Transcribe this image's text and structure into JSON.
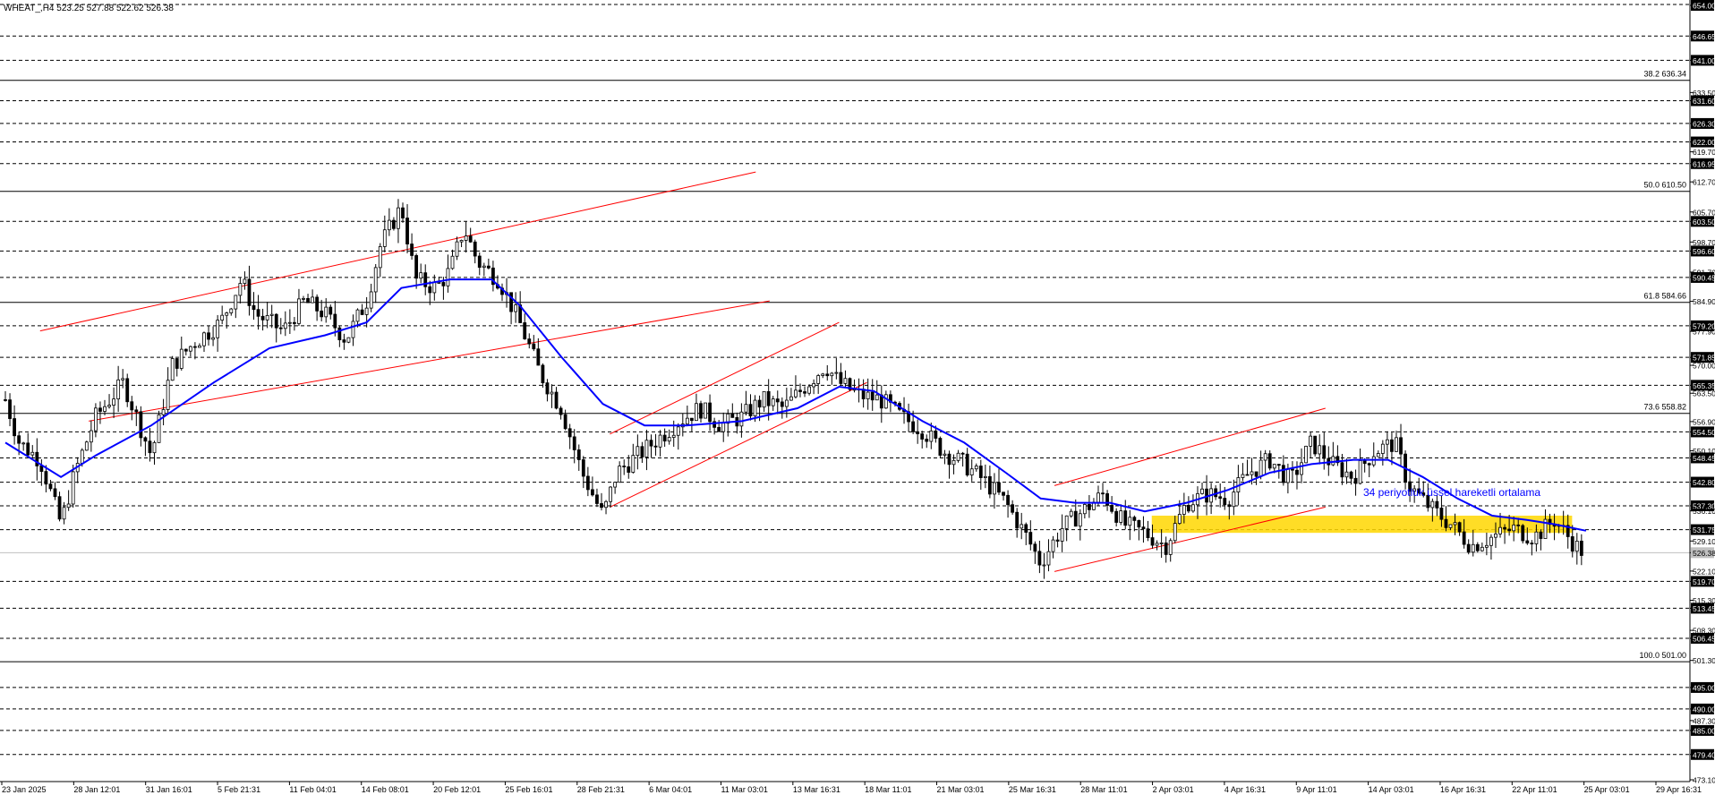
{
  "chart_data": {
    "type": "candlestick",
    "header": "WHEAT_,H4  523.25 527.88 522.62 526.38",
    "annotation": "34 periyotluk üssel hareketli ortalama",
    "colors": {
      "candle": "#000000",
      "ema": "#0000ff",
      "channel": "#ff0000",
      "support_zone": "#ffd700",
      "annotation_text": "#0000ff",
      "current_price_line": "#c0c0c0"
    },
    "y_axis": {
      "range": [
        473.1,
        654.0
      ],
      "tick_labels": [
        "654.00",
        "646.65",
        "641.00",
        "633.50",
        "631.60",
        "626.30",
        "622.00",
        "619.70",
        "616.95",
        "612.70",
        "605.70",
        "603.50",
        "598.70",
        "596.60",
        "591.70",
        "590.45",
        "584.90",
        "579.20",
        "577.90",
        "571.85",
        "570.00",
        "565.35",
        "563.50",
        "556.90",
        "554.50",
        "550.10",
        "548.45",
        "542.80",
        "537.30",
        "536.10",
        "531.75",
        "529.10",
        "526.38",
        "522.10",
        "519.70",
        "515.30",
        "513.45",
        "508.30",
        "506.45",
        "501.30",
        "495.00",
        "490.00",
        "487.30",
        "485.00",
        "479.40",
        "473.10"
      ],
      "highlighted_levels": [
        "654.00",
        "646.65",
        "641.00",
        "631.60",
        "626.30",
        "622.00",
        "616.95",
        "603.50",
        "596.60",
        "590.45",
        "579.20",
        "571.85",
        "565.35",
        "554.50",
        "548.45",
        "542.80",
        "537.30",
        "531.75",
        "526.38",
        "519.70",
        "513.45",
        "506.45",
        "495.00",
        "490.00",
        "485.00",
        "479.40"
      ]
    },
    "x_axis": {
      "tick_labels": [
        "23 Jan 2025",
        "28 Jan 12:01",
        "31 Jan 16:01",
        "5 Feb 21:31",
        "11 Feb 04:01",
        "14 Feb 08:01",
        "20 Feb 12:01",
        "25 Feb 16:01",
        "28 Feb 21:31",
        "6 Mar 04:01",
        "11 Mar 03:01",
        "13 Mar 16:31",
        "18 Mar 11:01",
        "21 Mar 03:01",
        "25 Mar 16:31",
        "28 Mar 11:01",
        "2 Apr 03:01",
        "4 Apr 16:31",
        "9 Apr 11:01",
        "14 Apr 03:01",
        "16 Apr 16:31",
        "22 Apr 11:01",
        "25 Apr 03:01",
        "29 Apr 16:31"
      ]
    },
    "dashed_levels": [
      654.0,
      646.65,
      641.0,
      631.6,
      626.3,
      622.0,
      616.95,
      603.5,
      596.6,
      590.45,
      579.2,
      571.85,
      565.35,
      554.5,
      548.45,
      542.8,
      537.3,
      531.75,
      519.7,
      513.45,
      506.45,
      495.0,
      490.0,
      485.0,
      479.4
    ],
    "fibonacci_levels": [
      {
        "label": "38.2 636.34",
        "value": 636.34
      },
      {
        "label": "50.0 610.50",
        "value": 610.5
      },
      {
        "label": "61.8 584.66",
        "value": 584.66
      },
      {
        "label": "73.6 558.82",
        "value": 558.82
      },
      {
        "label": "100.0 501.00",
        "value": 501.0
      }
    ],
    "current_price": 526.38,
    "support_zone": {
      "from": 531.0,
      "to": 535.0
    },
    "channels": [
      {
        "upper": [
          [
            0.5,
            578.0
          ],
          [
            10.8,
            615.0
          ]
        ],
        "lower": [
          [
            1.2,
            557.0
          ],
          [
            11.0,
            585.0
          ]
        ]
      },
      {
        "upper": [
          [
            8.7,
            554.0
          ],
          [
            12.0,
            580.0
          ]
        ],
        "lower": [
          [
            8.7,
            537.0
          ],
          [
            12.4,
            566.0
          ]
        ]
      },
      {
        "upper": [
          [
            15.1,
            542.0
          ],
          [
            19.0,
            560.0
          ]
        ],
        "lower": [
          [
            15.1,
            522.0
          ],
          [
            19.0,
            537.0
          ]
        ]
      }
    ],
    "price_path": [
      [
        0.0,
        562
      ],
      [
        0.2,
        552
      ],
      [
        0.5,
        548
      ],
      [
        0.8,
        533
      ],
      [
        1.0,
        545
      ],
      [
        1.3,
        558
      ],
      [
        1.7,
        566
      ],
      [
        2.1,
        549
      ],
      [
        2.4,
        570
      ],
      [
        2.7,
        575
      ],
      [
        3.1,
        580
      ],
      [
        3.4,
        590
      ],
      [
        3.6,
        582
      ],
      [
        4.0,
        578
      ],
      [
        4.3,
        585
      ],
      [
        4.6,
        582
      ],
      [
        4.9,
        576
      ],
      [
        5.2,
        585
      ],
      [
        5.4,
        598
      ],
      [
        5.6,
        604
      ],
      [
        5.7,
        607
      ],
      [
        5.9,
        590
      ],
      [
        6.2,
        588
      ],
      [
        6.4,
        592
      ],
      [
        6.6,
        602
      ],
      [
        6.8,
        594
      ],
      [
        7.1,
        590
      ],
      [
        7.4,
        580
      ],
      [
        7.7,
        568
      ],
      [
        8.0,
        560
      ],
      [
        8.3,
        545
      ],
      [
        8.6,
        535
      ],
      [
        8.8,
        545
      ],
      [
        9.1,
        549
      ],
      [
        9.4,
        553
      ],
      [
        9.7,
        557
      ],
      [
        10.0,
        560
      ],
      [
        10.3,
        556
      ],
      [
        10.6,
        558
      ],
      [
        10.9,
        562
      ],
      [
        11.2,
        560
      ],
      [
        11.5,
        565
      ],
      [
        11.8,
        570
      ],
      [
        12.0,
        566
      ],
      [
        12.3,
        563
      ],
      [
        12.6,
        562
      ],
      [
        12.9,
        558
      ],
      [
        13.2,
        555
      ],
      [
        13.5,
        550
      ],
      [
        13.8,
        547
      ],
      [
        14.1,
        543
      ],
      [
        14.4,
        538
      ],
      [
        14.7,
        530
      ],
      [
        14.9,
        524
      ],
      [
        15.2,
        532
      ],
      [
        15.5,
        536
      ],
      [
        15.8,
        540
      ],
      [
        16.1,
        533
      ],
      [
        16.4,
        531
      ],
      [
        16.7,
        528
      ],
      [
        17.0,
        538
      ],
      [
        17.3,
        540
      ],
      [
        17.6,
        539
      ],
      [
        17.9,
        545
      ],
      [
        18.2,
        548
      ],
      [
        18.5,
        543
      ],
      [
        18.8,
        552
      ],
      [
        19.1,
        547
      ],
      [
        19.4,
        544
      ],
      [
        19.7,
        550
      ],
      [
        20.0,
        552
      ],
      [
        20.2,
        542
      ],
      [
        20.5,
        537
      ],
      [
        20.8,
        533
      ],
      [
        21.1,
        528
      ],
      [
        21.4,
        530
      ],
      [
        21.7,
        532
      ],
      [
        22.0,
        530
      ],
      [
        22.3,
        534
      ],
      [
        22.6,
        528
      ],
      [
        22.75,
        526
      ]
    ],
    "ema_path": [
      [
        0.0,
        552
      ],
      [
        0.8,
        544
      ],
      [
        1.3,
        549
      ],
      [
        2.1,
        556
      ],
      [
        3.0,
        566
      ],
      [
        3.8,
        574
      ],
      [
        4.6,
        577
      ],
      [
        5.2,
        580
      ],
      [
        5.7,
        588
      ],
      [
        6.4,
        590
      ],
      [
        7.0,
        590
      ],
      [
        7.4,
        584
      ],
      [
        8.0,
        572
      ],
      [
        8.6,
        561
      ],
      [
        9.2,
        556
      ],
      [
        9.8,
        556
      ],
      [
        10.6,
        557
      ],
      [
        11.4,
        560
      ],
      [
        12.0,
        565
      ],
      [
        12.5,
        564
      ],
      [
        13.2,
        557
      ],
      [
        13.8,
        552
      ],
      [
        14.4,
        545
      ],
      [
        14.9,
        539
      ],
      [
        15.4,
        538
      ],
      [
        15.9,
        538
      ],
      [
        16.4,
        536
      ],
      [
        17.0,
        538
      ],
      [
        17.6,
        541
      ],
      [
        18.2,
        545
      ],
      [
        18.8,
        547
      ],
      [
        19.4,
        548
      ],
      [
        19.9,
        548
      ],
      [
        20.4,
        544
      ],
      [
        20.9,
        539
      ],
      [
        21.4,
        535
      ],
      [
        21.9,
        534
      ],
      [
        22.3,
        533
      ],
      [
        22.75,
        531.5
      ]
    ]
  }
}
